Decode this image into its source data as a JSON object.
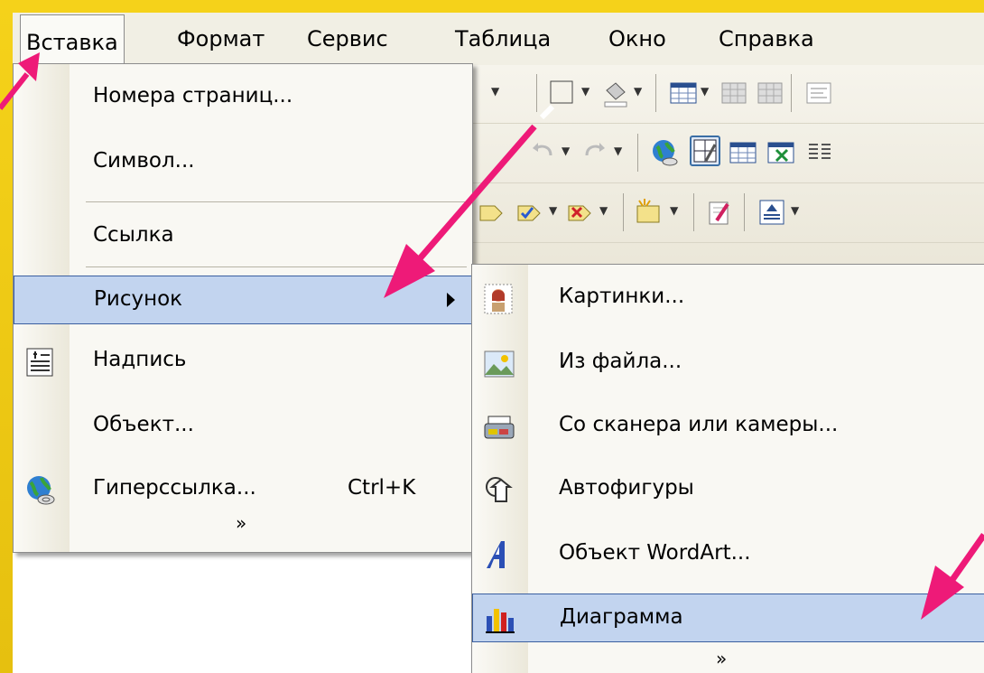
{
  "menubar": {
    "items": [
      "Вставка",
      "Формат",
      "Сервис",
      "Таблица",
      "Окно",
      "Справка"
    ]
  },
  "insert_menu": {
    "items": [
      {
        "label": "Номера страниц...",
        "icon": ""
      },
      {
        "label": "Символ...",
        "icon": ""
      },
      {
        "label": "Ссылка",
        "icon": ""
      },
      {
        "label": "Рисунок",
        "icon": "",
        "submenu": true
      },
      {
        "label": "Надпись",
        "icon": "text-box-icon"
      },
      {
        "label": "Объект...",
        "icon": ""
      },
      {
        "label": "Гиперссылка...",
        "shortcut": "Ctrl+K",
        "icon": "globe-link-icon"
      }
    ],
    "more": "»"
  },
  "picture_submenu": {
    "items": [
      {
        "label": "Картинки...",
        "icon": "clipart-icon"
      },
      {
        "label": "Из файла...",
        "icon": "picture-file-icon"
      },
      {
        "label": "Со сканера или камеры...",
        "icon": "scanner-icon"
      },
      {
        "label": "Автофигуры",
        "icon": "autoshapes-icon"
      },
      {
        "label": "Объект WordArt...",
        "icon": "wordart-icon"
      },
      {
        "label": "Диаграмма",
        "icon": "chart-icon"
      }
    ],
    "more": "»"
  },
  "colors": {
    "frame": "#e6c00f",
    "highlight": "#c2d4ef",
    "highlight_border": "#3b5fa0",
    "annotation_arrow": "#ee1a78"
  }
}
